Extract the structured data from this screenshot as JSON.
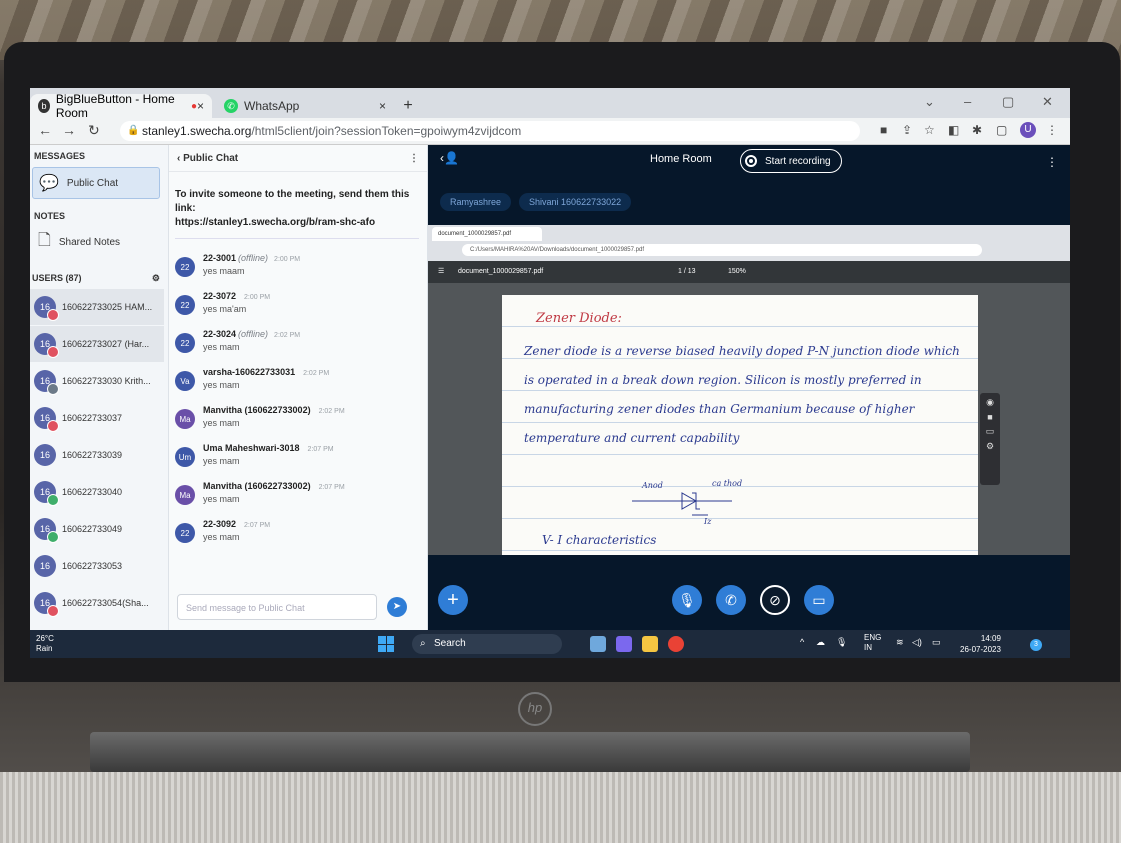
{
  "browser": {
    "tabs": [
      {
        "label": "BigBlueButton - Home Room",
        "recording": "●",
        "close": "×"
      },
      {
        "label": "WhatsApp",
        "close": "×"
      }
    ],
    "new_tab": "+",
    "address": {
      "host": "stanley1.swecha.org",
      "path": "/html5client/join?sessionToken=gpoiwym4zvijdcom"
    },
    "profile_initial": "U"
  },
  "sidebar": {
    "messages_title": "MESSAGES",
    "public_chat": "Public Chat",
    "notes_title": "NOTES",
    "shared_notes": "Shared Notes",
    "users_title": "USERS (87)",
    "users": [
      {
        "num": "16",
        "name": "160622733025 HAM...",
        "status_color": "#e05260"
      },
      {
        "num": "16",
        "name": "160622733027 (Har...",
        "status_color": "#e05260"
      },
      {
        "num": "16",
        "name": "160622733030 Krith...",
        "status_color": "#6c7a89"
      },
      {
        "num": "16",
        "name": "160622733037",
        "status_color": "#e05260"
      },
      {
        "num": "16",
        "name": "160622733039",
        "status_color": ""
      },
      {
        "num": "16",
        "name": "160622733040",
        "status_color": "#3fae6b"
      },
      {
        "num": "16",
        "name": "160622733049",
        "status_color": "#3fae6b"
      },
      {
        "num": "16",
        "name": "160622733053",
        "status_color": ""
      },
      {
        "num": "16",
        "name": "160622733054(Sha...",
        "status_color": "#e05260"
      }
    ]
  },
  "chat": {
    "header": "Public Chat",
    "welcome_line1": "To invite someone to the meeting, send them this link:",
    "welcome_link": "https://stanley1.swecha.org/b/ram-shc-afo",
    "messages": [
      {
        "avatar": "22",
        "name": "22-3001",
        "offline": "(offline)",
        "time": "2:00 PM",
        "text": "yes maam"
      },
      {
        "avatar": "22",
        "name": "22-3072",
        "offline": "",
        "time": "2:00 PM",
        "text": "yes ma'am"
      },
      {
        "avatar": "22",
        "name": "22-3024",
        "offline": "(offline)",
        "time": "2:02 PM",
        "text": "yes mam"
      },
      {
        "avatar": "Va",
        "name": "varsha-160622733031",
        "offline": "",
        "time": "2:02 PM",
        "text": "yes mam"
      },
      {
        "avatar": "Ma",
        "name": "Manvitha (160622733002)",
        "offline": "",
        "time": "2:02 PM",
        "text": "yes mam"
      },
      {
        "avatar": "Um",
        "name": "Uma Maheshwari-3018",
        "offline": "",
        "time": "2:07 PM",
        "text": "yes mam"
      },
      {
        "avatar": "Ma",
        "name": "Manvitha (160622733002)",
        "offline": "",
        "time": "2:07 PM",
        "text": "yes mam"
      },
      {
        "avatar": "22",
        "name": "22-3092",
        "offline": "",
        "time": "2:07 PM",
        "text": "yes mam"
      }
    ],
    "input_placeholder": "Send message to Public Chat"
  },
  "main": {
    "room_title": "Home Room",
    "record_label": "Start recording",
    "talkers": [
      "Ramyashree",
      "Shivani 160622733022"
    ],
    "presentation": {
      "inner_tab": "document_1000029857.pdf",
      "inner_url": "C:/Users/MAHIRA%20AV/Downloads/document_1000029857.pdf",
      "pdf_title": "document_1000029857.pdf",
      "page_indicator": "1 / 13",
      "zoom": "150%",
      "note_title": "Zener Diode:",
      "note_body": "Zener diode is a reverse biased heavily doped P-N junction diode which is operated in a break down region. Silicon is mostly preferred in manufacturing zener diodes than Germanium because of higher temperature and current capability",
      "anode": "Anod",
      "cathode": "ca thod",
      "iz": "Iz",
      "tail": "V- I characteristics"
    }
  },
  "taskbar": {
    "temp": "26°C",
    "weather": "Rain",
    "search": "Search",
    "lang": "ENG",
    "region": "IN",
    "time": "14:09",
    "date": "26-07-2023",
    "notifications": "3"
  },
  "brand": "hp"
}
